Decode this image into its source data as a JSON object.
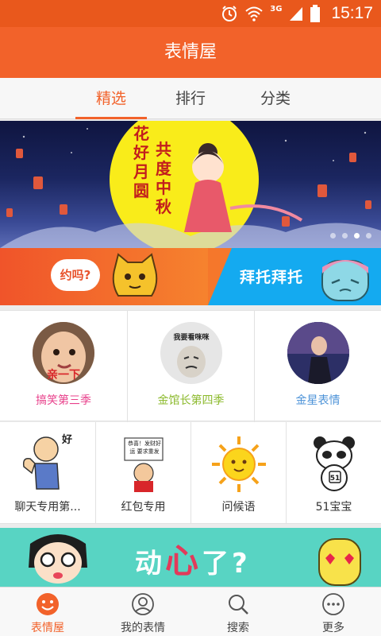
{
  "status_bar": {
    "time": "15:17",
    "network": "3G"
  },
  "app": {
    "title": "表情屋"
  },
  "tabs": [
    {
      "label": "精选"
    },
    {
      "label": "排行"
    },
    {
      "label": "分类"
    }
  ],
  "banner": {
    "poem_left": "花好月圆",
    "poem_right": "共度中秋"
  },
  "promos": {
    "left_bubble": "约吗?",
    "right_text": "拜托拜托"
  },
  "featured": [
    {
      "label": "搞笑第三季",
      "color": "#e8408b",
      "avatar_caption": "亲一下"
    },
    {
      "label": "金馆长第四季",
      "color": "#8cba2d",
      "avatar_caption": "我要看咪咪"
    },
    {
      "label": "金星表情",
      "color": "#4d93d8",
      "avatar_caption": ""
    }
  ],
  "categories": [
    {
      "label": "聊天专用第...",
      "art_text": "好"
    },
    {
      "label": "红包专用",
      "art_text": "恭喜！发财好运 要求重发"
    },
    {
      "label": "问候语"
    },
    {
      "label": "51宝宝",
      "art_text": "51"
    }
  ],
  "bottom_banner": {
    "pre": "动",
    "heart": "心",
    "post": "了?"
  },
  "nav": [
    {
      "label": "表情屋",
      "active": true
    },
    {
      "label": "我的表情"
    },
    {
      "label": "搜索"
    },
    {
      "label": "更多"
    }
  ],
  "colors": {
    "accent": "#f2622a",
    "status_bar": "#e9581c",
    "promo_blue": "#14aaf0",
    "banner_teal": "#58d4c3"
  }
}
